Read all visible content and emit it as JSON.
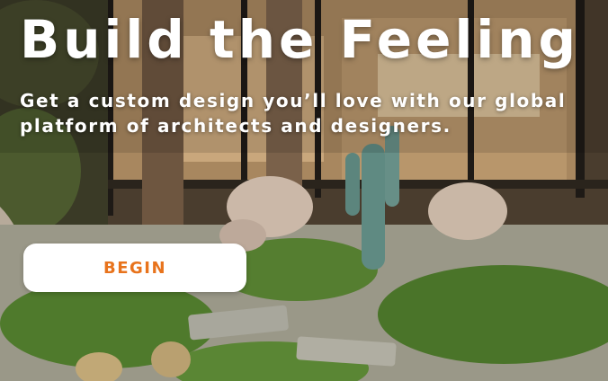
{
  "hero": {
    "headline": "Build the Feeling",
    "subheadline": "Get a custom design you’ll love with our global platform of architects and designers.",
    "cta_label": "BEGIN",
    "background_image": "garden-courtyard-photo"
  },
  "colors": {
    "cta_text": "#e8731c",
    "cta_background": "#ffffff",
    "headline_text": "#ffffff"
  }
}
